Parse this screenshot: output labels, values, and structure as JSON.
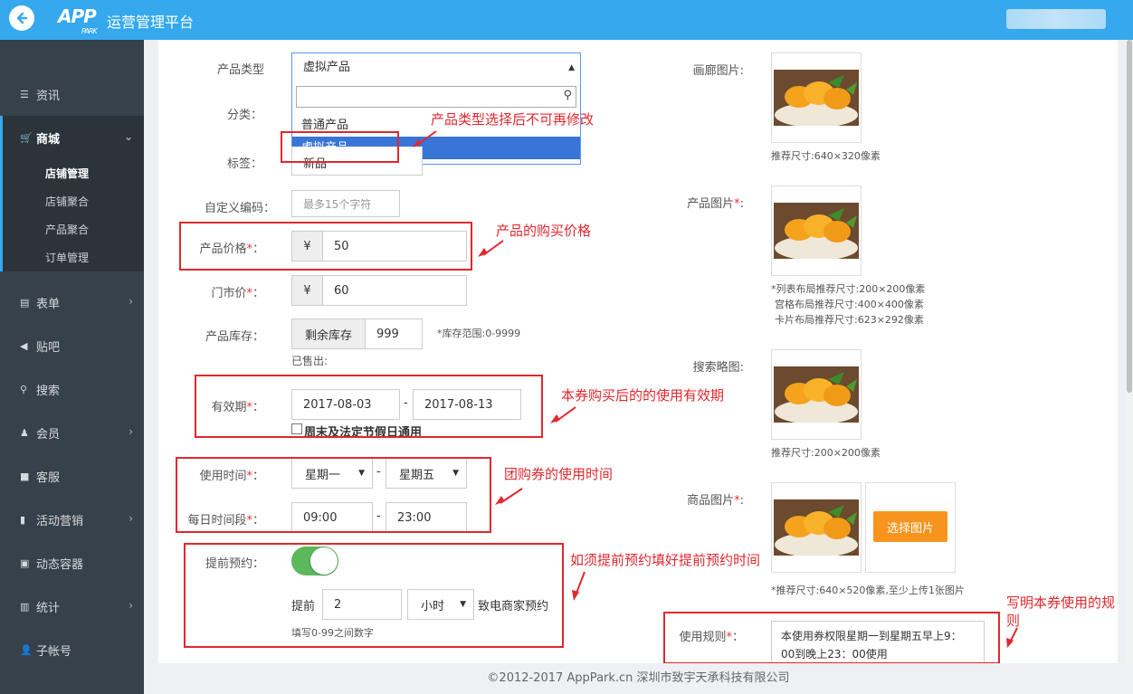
{
  "header": {
    "logo_text": "APP",
    "logo_sub": "PARK",
    "platform_title": "运营管理平台"
  },
  "sidebar": {
    "items": [
      {
        "label": "资讯"
      },
      {
        "label": "商城"
      },
      {
        "label": "表单"
      },
      {
        "label": "贴吧"
      },
      {
        "label": "搜索"
      },
      {
        "label": "会员"
      },
      {
        "label": "客服"
      },
      {
        "label": "活动营销"
      },
      {
        "label": "动态容器"
      },
      {
        "label": "统计"
      },
      {
        "label": "子帐号"
      }
    ],
    "sub_items": [
      {
        "label": "店铺管理"
      },
      {
        "label": "店铺聚合"
      },
      {
        "label": "产品聚合"
      },
      {
        "label": "订单管理"
      }
    ]
  },
  "form": {
    "product_type_label": "产品类型",
    "product_type_value": "虚拟产品",
    "dropdown_options": [
      "普通产品",
      "虚拟产品"
    ],
    "category_label": "分类：",
    "tag_label": "标签：",
    "tag_value": "新品",
    "custom_code_label": "自定义编码：",
    "custom_code_placeholder": "最多15个字符",
    "price_label": "产品价格",
    "currency": "¥",
    "price_value": "50",
    "market_price_label": "门市价",
    "market_price_value": "60",
    "stock_label": "产品库存：",
    "stock_addon": "剩余库存",
    "stock_value": "999",
    "stock_hint": "*库存范围:0-9999",
    "sold_label": "已售出:",
    "validity_label": "有效期",
    "validity_start": "2017-08-03",
    "validity_end": "2017-08-13",
    "holiday_label": "周末及法定节假日通用",
    "use_time_label": "使用时间",
    "use_day_start": "星期一",
    "use_day_end": "星期五",
    "daily_time_label": "每日时间段",
    "daily_start": "09:00",
    "daily_end": "23:00",
    "reserve_label": "提前预约：",
    "reserve_prefix": "提前",
    "reserve_value": "2",
    "reserve_unit": "小时",
    "reserve_suffix": "致电商家预约",
    "reserve_hint": "填写0-99之间数字",
    "rules_label": "使用规则",
    "rules_value": "本使用券权限星期一到星期五早上9：00到晚上23：00使用"
  },
  "images": {
    "gallery_label": "画廊图片:",
    "gallery_hint": "推荐尺寸:640×320像素",
    "product_label": "产品图片",
    "product_hints": [
      "*列表布局推荐尺寸:200×200像素",
      "宫格布局推荐尺寸:400×400像素",
      "卡片布局推荐尺寸:623×292像素"
    ],
    "search_label": "搜索略图:",
    "search_hint": "推荐尺寸:200×200像素",
    "goods_label": "商品图片",
    "goods_hint": "*推荐尺寸:640×520像素,至少上传1张图片",
    "choose_button": "选择图片"
  },
  "annotations": {
    "type_note": "产品类型选择后不可再修改",
    "price_note": "产品的购买价格",
    "validity_note": "本券购买后的的使用有效期",
    "use_time_note": "团购券的使用时间",
    "reserve_note": "如须提前预约填好提前预约时间",
    "rules_note_line1": "写明本券使用的规",
    "rules_note_line2": "则"
  },
  "footer": {
    "copyright": "©2012-2017 AppPark.cn 深圳市致宇天承科技有限公司"
  },
  "colors": {
    "header": "#35a8ee",
    "sidebar": "#37414b",
    "annotation": "#e0282e",
    "toggle_on": "#5cb85c",
    "choose_button": "#f7941d"
  }
}
